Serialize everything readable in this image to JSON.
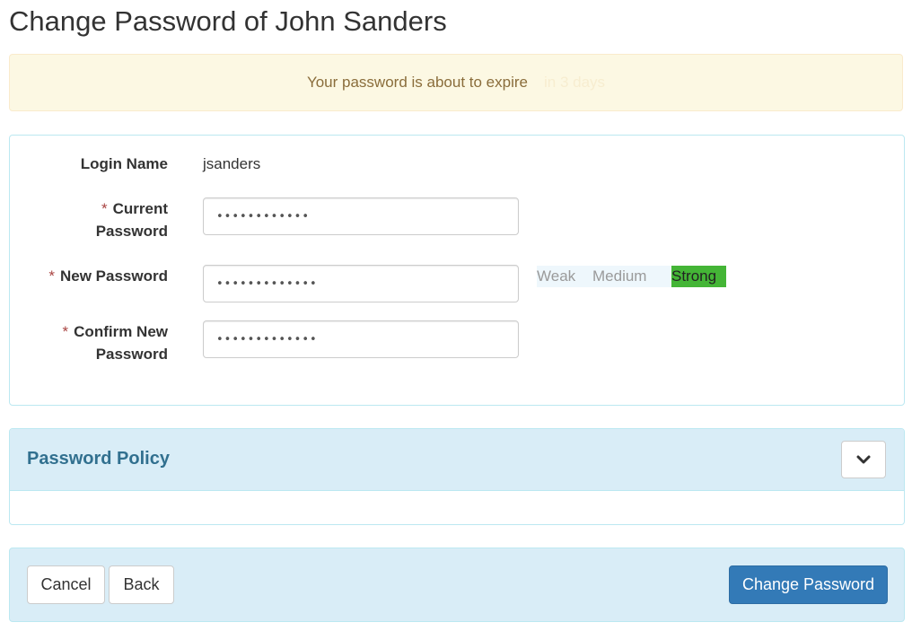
{
  "page": {
    "title": "Change Password of John Sanders"
  },
  "alert": {
    "message": "Your password is about to expire",
    "faint_text": "in 3 days"
  },
  "form": {
    "login_name_label": "Login Name",
    "login_name_value": "jsanders",
    "required_marker": "*",
    "current_password_label_line1": "Current",
    "current_password_label_line2": "Password",
    "current_password_value": "••••••••••••",
    "new_password_label": "New Password",
    "new_password_value": "•••••••••••••",
    "confirm_password_label_line1": "Confirm New",
    "confirm_password_label_line2": "Password",
    "confirm_password_value": "•••••••••••••"
  },
  "strength_meter": {
    "levels": [
      "Weak",
      "Medium",
      "Strong"
    ],
    "active_level": "Strong",
    "active_color": "#44b536"
  },
  "policy": {
    "title": "Password Policy",
    "toggle_icon": "chevron-down-icon"
  },
  "footer": {
    "cancel_label": "Cancel",
    "back_label": "Back",
    "submit_label": "Change Password"
  },
  "colors": {
    "primary": "#337ab7",
    "alert_bg": "#fcf8e3",
    "alert_text": "#8a6d3b",
    "panel_heading_bg": "#d9edf7",
    "panel_heading_text": "#31708f",
    "required": "#a94442"
  }
}
